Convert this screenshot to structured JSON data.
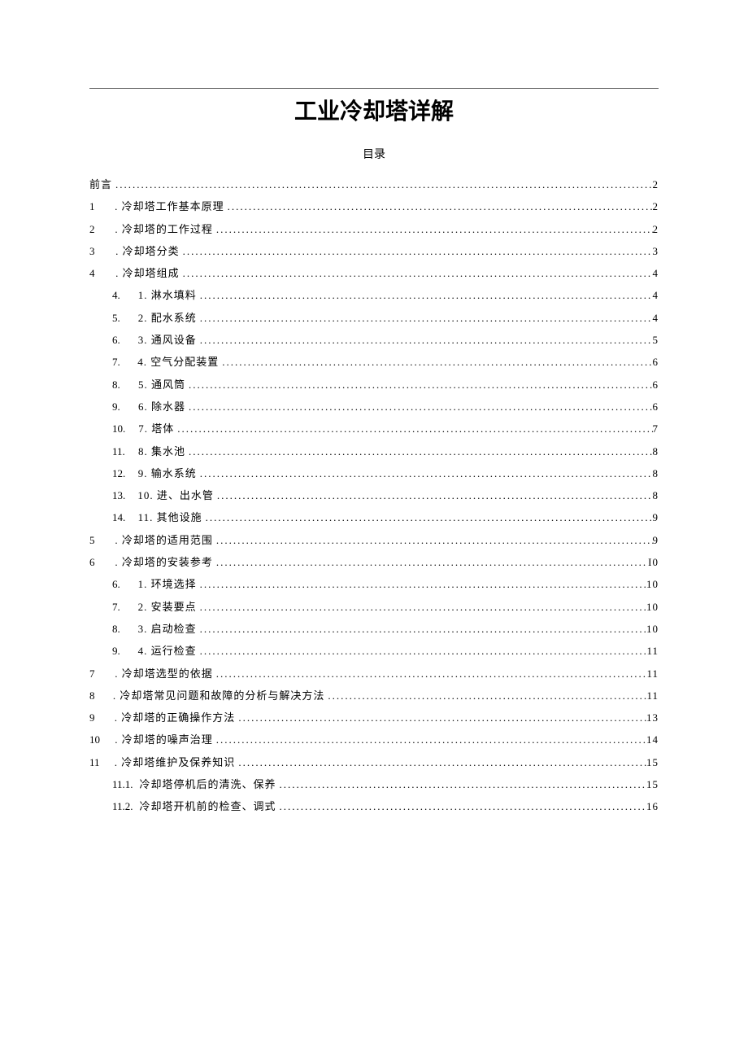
{
  "title": "工业冷却塔详解",
  "tocHeading": "目录",
  "entries": [
    {
      "indent": 0,
      "num": "",
      "label": "前言",
      "page": "2"
    },
    {
      "indent": 0,
      "num": "1",
      "label": ". 冷却塔工作基本原理",
      "page": "2"
    },
    {
      "indent": 0,
      "num": "2",
      "label": ". 冷却塔的工作过程",
      "page": "2"
    },
    {
      "indent": 0,
      "num": "3",
      "label": ". 冷却塔分类",
      "page": "3"
    },
    {
      "indent": 0,
      "num": "4",
      "label": ". 冷却塔组成",
      "page": "4"
    },
    {
      "indent": 1,
      "num": "4.",
      "label": "1. 淋水填料",
      "page": "4"
    },
    {
      "indent": 1,
      "num": "5.",
      "label": "2. 配水系统",
      "page": "4"
    },
    {
      "indent": 1,
      "num": "6.",
      "label": "3. 通风设备",
      "page": "5"
    },
    {
      "indent": 1,
      "num": "7.",
      "label": "4. 空气分配装置",
      "page": "6"
    },
    {
      "indent": 1,
      "num": "8.",
      "label": "5. 通风筒",
      "page": "6"
    },
    {
      "indent": 1,
      "num": "9.",
      "label": "6. 除水器",
      "page": "6"
    },
    {
      "indent": 1,
      "num": "10.",
      "label": "7. 塔体",
      "page": "7"
    },
    {
      "indent": 1,
      "num": "11.",
      "label": "8. 集水池",
      "page": "8"
    },
    {
      "indent": 1,
      "num": "12.",
      "label": "9. 输水系统",
      "page": "8"
    },
    {
      "indent": 1,
      "num": "13.",
      "label": "10. 进、出水管",
      "page": "8"
    },
    {
      "indent": 1,
      "num": "14.",
      "label": "11. 其他设施",
      "page": "9"
    },
    {
      "indent": 0,
      "num": "5",
      "label": ". 冷却塔的适用范围",
      "page": "9"
    },
    {
      "indent": 0,
      "num": "6",
      "label": ". 冷却塔的安装参考",
      "page": "I0"
    },
    {
      "indent": 1,
      "num": "6.",
      "label": "1. 环境选择",
      "page": "10"
    },
    {
      "indent": 1,
      "num": "7.",
      "label": "2. 安装要点",
      "page": "10"
    },
    {
      "indent": 1,
      "num": "8.",
      "label": "3. 启动检查",
      "page": "10"
    },
    {
      "indent": 1,
      "num": "9.",
      "label": "4. 运行检查",
      "page": "11"
    },
    {
      "indent": 0,
      "num": "7",
      "label": ". 冷却塔选型的依据",
      "page": "11"
    },
    {
      "indent": 0,
      "num": "8",
      "label": ". 冷却塔常见问题和故障的分析与解决方法",
      "page": "11"
    },
    {
      "indent": 0,
      "num": "9",
      "label": ". 冷却塔的正确操作方法",
      "page": "13"
    },
    {
      "indent": 0,
      "num": "10",
      "label": ". 冷却塔的噪声治理",
      "page": "14"
    },
    {
      "indent": 0,
      "num": "11",
      "label": ". 冷却塔维护及保养知识",
      "page": "15"
    },
    {
      "indent": 1,
      "num": "11.1.",
      "label": " 冷却塔停机后的清洗、保养",
      "page": "15"
    },
    {
      "indent": 1,
      "num": "11.2.",
      "label": " 冷却塔开机前的检查、调式",
      "page": "16"
    }
  ]
}
